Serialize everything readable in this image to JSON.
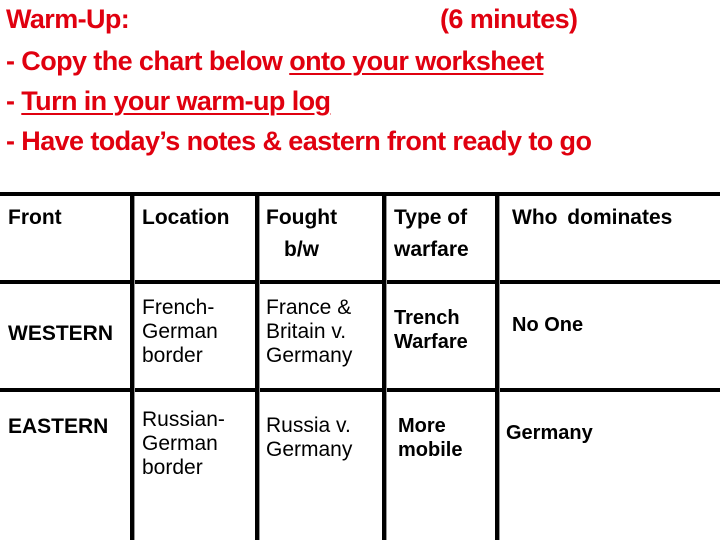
{
  "header": {
    "title": "Warm-Up:",
    "duration": "(6 minutes)",
    "lines": [
      {
        "prefix": "- ",
        "text": "Copy the chart below ",
        "underlined": "onto your worksheet"
      },
      {
        "prefix": "- ",
        "text": "",
        "underlined": "Turn in your warm-up log"
      },
      {
        "prefix": "- ",
        "text": "Have today’s notes & eastern front ready to go",
        "underlined": ""
      }
    ]
  },
  "table": {
    "columns": [
      "Front",
      "Location",
      "Fought b/w",
      "Type of warfare",
      "Who dominates"
    ],
    "column_lines": {
      "fought": [
        "Fought",
        "b/w"
      ],
      "type": [
        "Type of",
        "warfare"
      ]
    },
    "rows": [
      {
        "front": "WESTERN",
        "location": [
          "French-",
          "German",
          "border"
        ],
        "fought": [
          "France &",
          "Britain v.",
          "Germany"
        ],
        "type": [
          "Trench",
          "Warfare"
        ],
        "dominates": "No One"
      },
      {
        "front": "EASTERN",
        "location": [
          "Russian-",
          "German",
          "border"
        ],
        "fought": [
          "Russia v.",
          "Germany"
        ],
        "type": [
          "More",
          "mobile"
        ],
        "dominates": "Germany"
      }
    ]
  }
}
